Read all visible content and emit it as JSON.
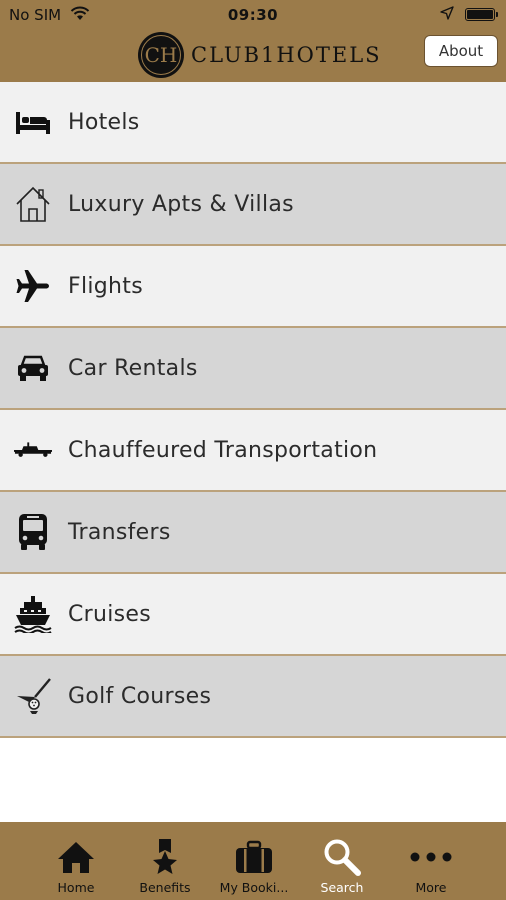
{
  "status_bar": {
    "carrier": "No SIM",
    "time": "09:30"
  },
  "header": {
    "logo_monogram": "CH",
    "brand": "CLUB1HOTELS",
    "about_label": "About"
  },
  "menu": [
    {
      "label": "Hotels",
      "icon": "bed-icon"
    },
    {
      "label": "Luxury Apts & Villas",
      "icon": "house-icon"
    },
    {
      "label": "Flights",
      "icon": "airplane-icon"
    },
    {
      "label": "Car Rentals",
      "icon": "car-icon"
    },
    {
      "label": "Chauffeured Transportation",
      "icon": "limousine-icon"
    },
    {
      "label": "Transfers",
      "icon": "bus-icon"
    },
    {
      "label": "Cruises",
      "icon": "cruise-ship-icon"
    },
    {
      "label": "Golf Courses",
      "icon": "golf-icon"
    }
  ],
  "tabs": [
    {
      "label": "Home",
      "icon": "home-icon",
      "active": false
    },
    {
      "label": "Benefits",
      "icon": "star-ribbon-icon",
      "active": false
    },
    {
      "label": "My Booki...",
      "icon": "suitcase-icon",
      "active": false
    },
    {
      "label": "Search",
      "icon": "search-icon",
      "active": true
    },
    {
      "label": "More",
      "icon": "more-dots-icon",
      "active": false
    }
  ],
  "colors": {
    "header_bg": "#9b7b4a",
    "row_light": "#f1f1f1",
    "row_dark": "#d6d6d6",
    "row_divider": "#bba27c",
    "active_tab_text": "#ffffff"
  }
}
